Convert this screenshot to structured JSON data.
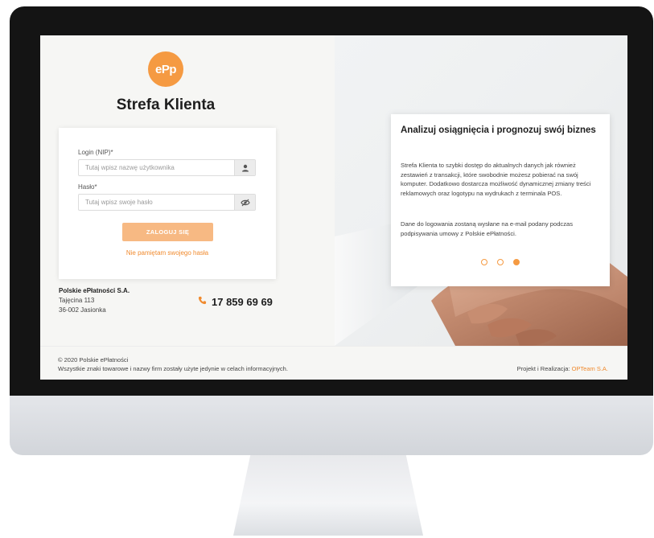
{
  "brand": {
    "logo_text": "ePp",
    "title": "Strefa Klienta",
    "accent": "#f59a42"
  },
  "login": {
    "login_label": "Login (NIP)*",
    "login_placeholder": "Tutaj wpisz nazwę użytkownika",
    "login_icon": "user-icon",
    "password_label": "Hasło*",
    "password_placeholder": "Tutaj wpisz swoje hasło",
    "password_icon": "eye-slash-icon",
    "submit_label": "ZALOGUJ SIĘ",
    "forgot_label": "Nie pamiętam swojego hasła"
  },
  "company": {
    "name": "Polskie ePłatności S.A.",
    "street": "Tajęcina 113",
    "city": "36-002 Jasionka",
    "phone": "17 859 69 69",
    "phone_icon": "phone-icon"
  },
  "promo": {
    "title": "Analizuj osiągnięcia i prognozuj swój biznes",
    "paragraph1": "Strefa Klienta to szybki dostęp do aktualnych danych jak również zestawień z transakcji, które swobodnie możesz pobierać na swój komputer. Dodatkowo dostarcza możliwość dynamicznej zmiany treści reklamowych oraz logotypu na wydrukach z terminala POS.",
    "paragraph2": "Dane do logowania zostaną wysłane na e-mail podany podczas podpisywania umowy z Polskie ePłatności.",
    "slide_count": 3,
    "active_slide": 3
  },
  "footer": {
    "copyright": "© 2020 Polskie ePłatności",
    "disclaimer": "Wszystkie znaki towarowe i nazwy firm zostały użyte jedynie w celach informacyjnych.",
    "credit_prefix": "Projekt i Realizacja:",
    "credit_link": "OPTeam S.A."
  }
}
